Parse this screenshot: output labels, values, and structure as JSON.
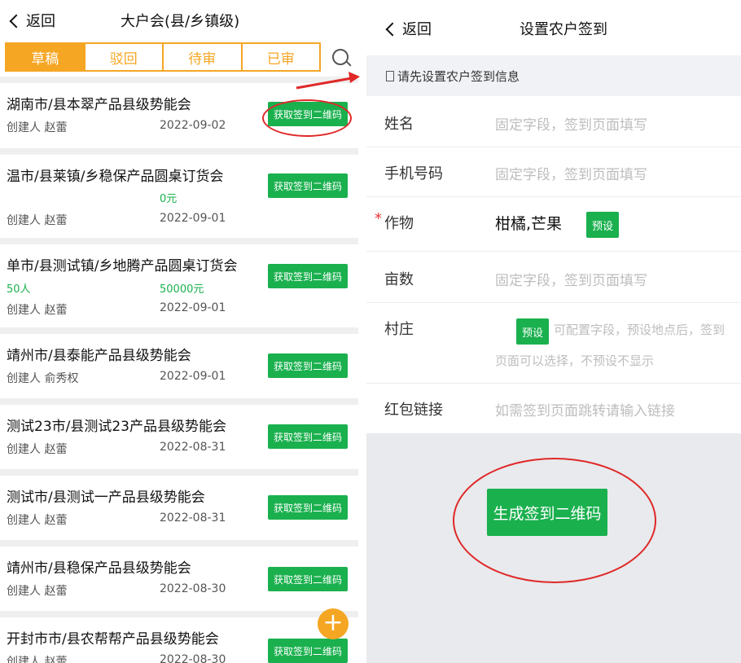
{
  "left": {
    "back_label": "返回",
    "title": "大户会(县/乡镇级)",
    "tabs": [
      "草稿",
      "驳回",
      "待审",
      "已审"
    ],
    "qr_label": "获取签到二维码",
    "fab_label": "+",
    "items": [
      {
        "title": "湖南市/县本翠产品县级势能会",
        "creator": "创建人  赵蕾",
        "date": "2022-09-02"
      },
      {
        "title": "温市/县莱镇/乡稳保产品圆桌订货会",
        "amount": "0元",
        "creator": "创建人  赵蕾",
        "date": "2022-09-01"
      },
      {
        "title": "单市/县测试镇/乡地腾产品圆桌订货会",
        "people": "50人",
        "amount": "50000元",
        "creator": "创建人  赵蕾",
        "date": "2022-09-01"
      },
      {
        "title": "靖州市/县泰能产品县级势能会",
        "creator": "创建人  俞秀权",
        "date": "2022-09-01"
      },
      {
        "title": "测试23市/县测试23产品县级势能会",
        "creator": "创建人  赵蕾",
        "date": "2022-08-31"
      },
      {
        "title": "测试市/县测试一产品县级势能会",
        "creator": "创建人  赵蕾",
        "date": "2022-08-31"
      },
      {
        "title": "靖州市/县稳保产品县级势能会",
        "creator": "创建人  赵蕾",
        "date": "2022-08-30"
      },
      {
        "title": "开封市市/县农帮帮产品县级势能会",
        "creator": "创建人  赵蕾",
        "date": "2022-08-30"
      }
    ]
  },
  "right": {
    "back_label": "返回",
    "title": "设置农户签到",
    "hint": "请先设置农户签到信息",
    "required_mark": "*",
    "fields": {
      "name": {
        "label": "姓名",
        "placeholder": "固定字段，签到页面填写"
      },
      "phone": {
        "label": "手机号码",
        "placeholder": "固定字段，签到页面填写"
      },
      "crop": {
        "label": "作物",
        "value": "柑橘,芒果",
        "preset": "预设"
      },
      "area": {
        "label": "亩数",
        "placeholder": "固定字段，签到页面填写"
      },
      "village": {
        "label": "村庄",
        "preset": "预设",
        "note_line1": "可配置字段，预设地点后，签到",
        "note_line2": "页面可以选择，不预设不显示"
      },
      "redpacket": {
        "label": "红包链接",
        "placeholder": "如需签到页面跳转请输入链接"
      }
    },
    "generate_label": "生成签到二维码"
  },
  "colors": {
    "accent_orange": "#f5a623",
    "primary_green": "#1ab04e",
    "annotation_red": "#e02828"
  }
}
